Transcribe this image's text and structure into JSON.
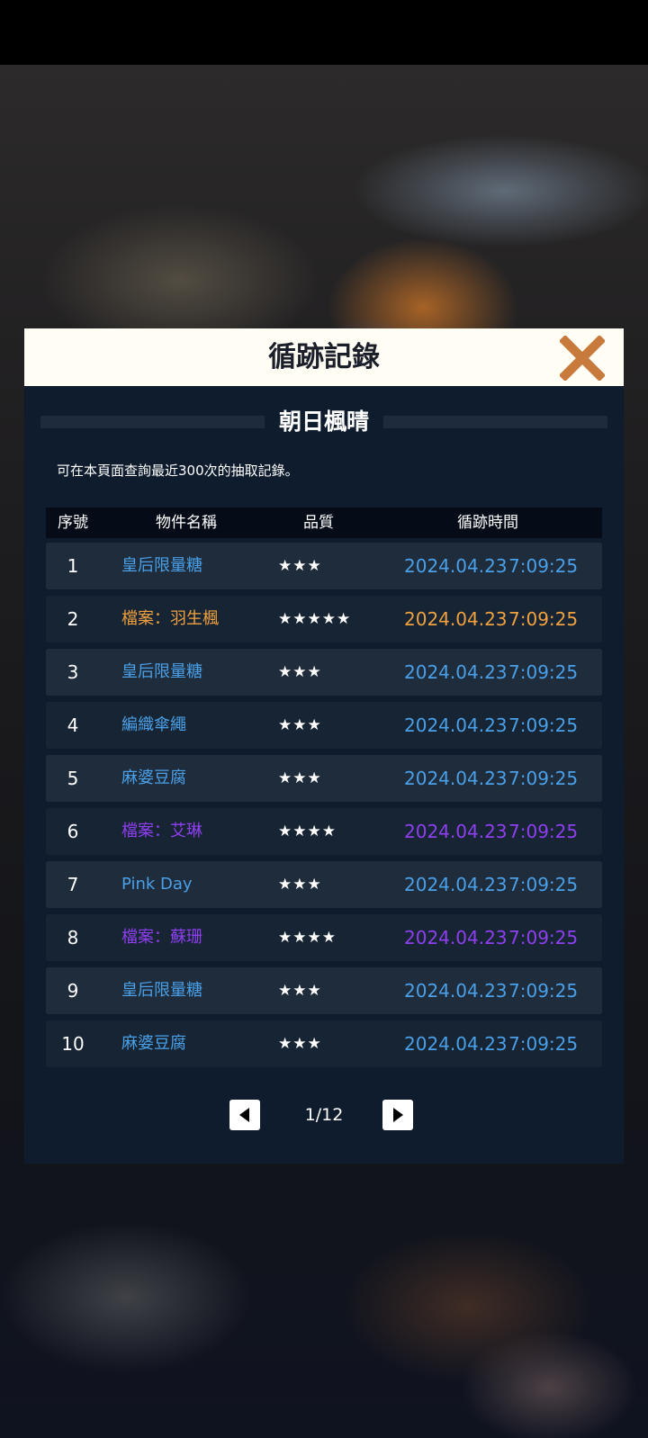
{
  "dialog": {
    "title": "循跡記錄",
    "subtitle": "朝日楓晴",
    "note": "可在本頁面查詢最近300次的抽取記錄。",
    "columns": [
      "序號",
      "物件名稱",
      "品質",
      "循跡時間"
    ],
    "rows": [
      {
        "index": "1",
        "name": "皇后限量糖",
        "stars": "★★★",
        "date": "2024.04.23",
        "time": "7:09:25",
        "quality": "q3"
      },
      {
        "index": "2",
        "name": "檔案：羽生楓",
        "stars": "★★★★★",
        "date": "2024.04.23",
        "time": "7:09:25",
        "quality": "q5"
      },
      {
        "index": "3",
        "name": "皇后限量糖",
        "stars": "★★★",
        "date": "2024.04.23",
        "time": "7:09:25",
        "quality": "q3"
      },
      {
        "index": "4",
        "name": "編織傘繩",
        "stars": "★★★",
        "date": "2024.04.23",
        "time": "7:09:25",
        "quality": "q3"
      },
      {
        "index": "5",
        "name": "麻婆豆腐",
        "stars": "★★★",
        "date": "2024.04.23",
        "time": "7:09:25",
        "quality": "q3"
      },
      {
        "index": "6",
        "name": "檔案：艾琳",
        "stars": "★★★★",
        "date": "2024.04.23",
        "time": "7:09:25",
        "quality": "q4"
      },
      {
        "index": "7",
        "name": "Pink Day",
        "stars": "★★★",
        "date": "2024.04.23",
        "time": "7:09:25",
        "quality": "q3"
      },
      {
        "index": "8",
        "name": "檔案：蘇珊",
        "stars": "★★★★",
        "date": "2024.04.23",
        "time": "7:09:25",
        "quality": "q4"
      },
      {
        "index": "9",
        "name": "皇后限量糖",
        "stars": "★★★",
        "date": "2024.04.23",
        "time": "7:09:25",
        "quality": "q3"
      },
      {
        "index": "10",
        "name": "麻婆豆腐",
        "stars": "★★★",
        "date": "2024.04.23",
        "time": "7:09:25",
        "quality": "q3"
      }
    ],
    "pager": {
      "label": "1/12",
      "prev_icon": "triangle-left-icon",
      "next_icon": "triangle-right-icon"
    },
    "close_icon": "close-x-icon"
  },
  "colors": {
    "quality_3": "#4aa0e8",
    "quality_4": "#8e3ff0",
    "quality_5": "#f0a13e",
    "close_icon": "#c77a3b",
    "panel": "#0f1c2d"
  }
}
